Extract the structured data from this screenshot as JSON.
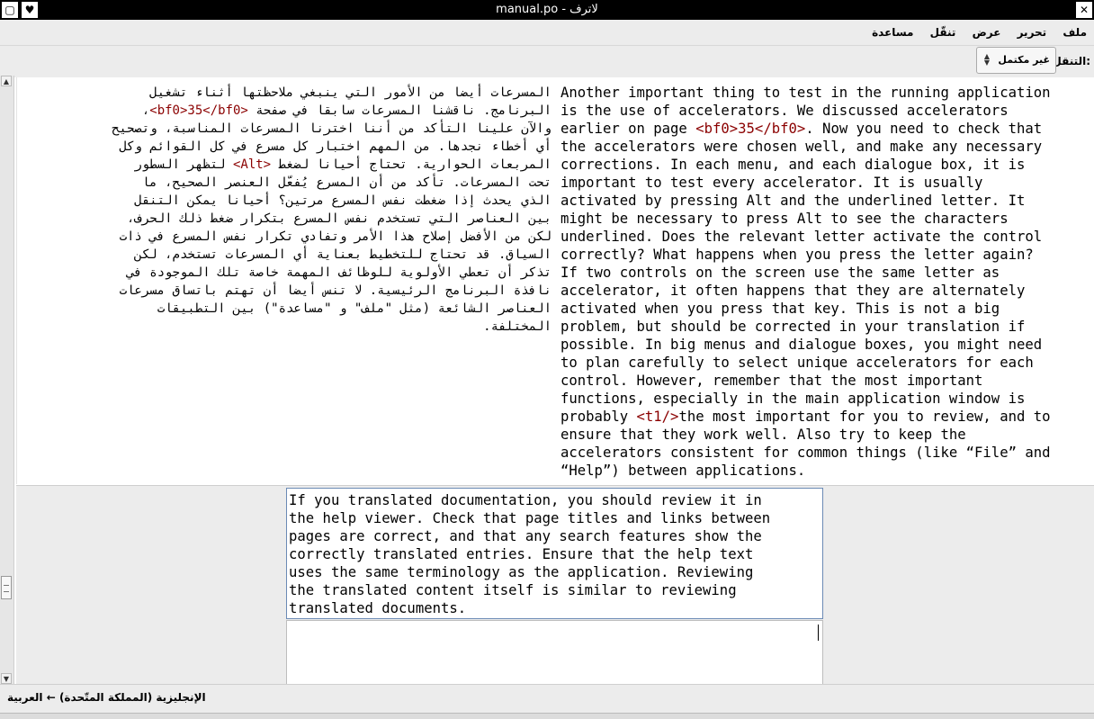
{
  "window": {
    "title": "manual.po - لاترف",
    "left_button_icon": "window-menu-icon",
    "left_button2_icon": "heart-icon",
    "close_icon": "close-icon"
  },
  "menu": {
    "items": [
      "ملف",
      "تحرير",
      "عرض",
      "تنقّل",
      "مساعدة"
    ]
  },
  "toolbar": {
    "nav_label": "التنقل:",
    "nav_value": "غير مكتمل"
  },
  "source_unit": {
    "arabic_lines": [
      "المسرعات أيضا من الأمور التي ينبغي ملاحظتها أثناء تشغيل",
      "البرنامج. ناقشنا المسرعات سابقا في صفحة ",
      "<bf0>35</bf0>",
      "،",
      "والآن علينا التأكد من أننا اخترنا المسرعات المناسبة، وتصحيح",
      "أي أخطاء نجدها. من المهم اختبار كل مسرع في كل القوائم وكل",
      "المربعات الحوارية. تحتاج أحيانا لضغط ",
      "<Alt>",
      " لتظهر السطور",
      "تحت المسرعات. تأكد من أن المسرع يُفعّل العنصر الصحيح، ما",
      "الذي يحدث إذا ضغطت نفس المسرع مرتين؟ أحيانا يمكن التنقل",
      "بين العناصر التي تستخدم نفس المسرع بتكرار ضغط ذلك الحرف،",
      "لكن من الأفضل إصلاح هذا الأمر وتفادي تكرار نفس المسرع في ذات",
      "السياق. قد تحتاج للتخطيط بعناية أي المسرعات تستخدم، لكن",
      "تذكر أن تعطي الأولوية للوظائف المهمة خاصة تلك الموجودة في",
      "نافذة البرنامج الرئيسية. لا تنس أيضا أن تهتم باتساق مسرعات",
      "العناصر الشائعة (مثل \"ملف\" و \"مساعدة\") بين التطبيقات",
      "المختلفة."
    ],
    "english_parts": [
      "Another important thing to test in the running application\nis the use of accelerators. We discussed accelerators\nearlier on page ",
      "<bf0>35</bf0>",
      ". Now you need to check that\nthe accelerators were chosen well, and make any necessary\ncorrections. In each menu, and each dialogue box, it is\nimportant to test every accelerator. It is usually\nactivated by pressing Alt and the underlined letter. It\nmight be necessary to press Alt to see the characters\nunderlined. Does the relevant letter activate the control\ncorrectly? What happens when you press the letter again?\nIf two controls on the screen use the same letter as\naccelerator, it often happens that they are alternately\nactivated when you press that key. This is not a big\nproblem, but should be corrected in your translation if\npossible. In big menus and dialogue boxes, you might need\nto plan carefully to select unique accelerators for each\ncontrol. However, remember that the most important\nfunctions, especially in the main application window is\nprobably ",
      "<t1/>",
      "the most important for you to review, and to\nensure that they work well. Also try to keep the\naccelerators consistent for common things (like “File” and\n“Help”) between applications."
    ]
  },
  "current_unit": {
    "source_text": "If you translated documentation, you should review it in\nthe help viewer. Check that page titles and links between\npages are correct, and that any search features show the\ncorrectly translated entries. Ensure that the help text\nuses the same terminology as the application. Reviewing\nthe translated content itself is similar to reviewing\ntranslated documents.",
    "translation_text": ""
  },
  "status": {
    "language_pair": "الإنجليزية (المملكة المتّحدة) ← العربية"
  }
}
